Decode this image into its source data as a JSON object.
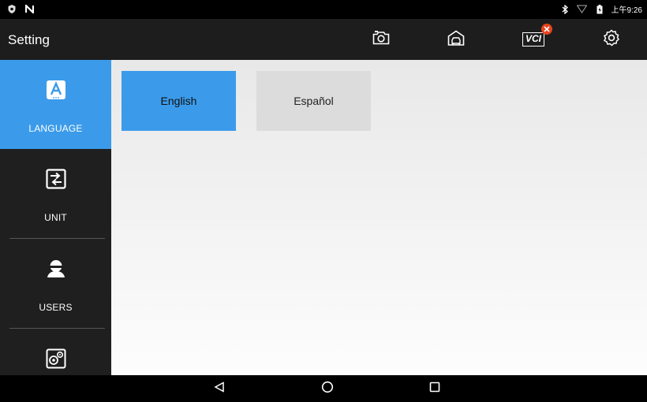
{
  "status_bar": {
    "time": "上午9:26",
    "left_icons": [
      "shield-icon",
      "n-icon"
    ],
    "right_icons": [
      "bluetooth-icon",
      "wifi-icon",
      "battery-icon"
    ]
  },
  "app_bar": {
    "title": "Setting",
    "actions": [
      "camera-icon",
      "garage-icon",
      "vci-icon",
      "gear-icon"
    ],
    "vci_label": "VCI",
    "vci_status": "disconnected"
  },
  "sidebar": {
    "items": [
      {
        "label": "LANGUAGE",
        "icon": "language-icon",
        "active": true
      },
      {
        "label": "UNIT",
        "icon": "unit-icon",
        "active": false
      },
      {
        "label": "USERS",
        "icon": "user-icon",
        "active": false
      },
      {
        "label": "",
        "icon": "system-settings-icon",
        "active": false
      }
    ]
  },
  "languages": [
    {
      "label": "English",
      "selected": true
    },
    {
      "label": "Español",
      "selected": false
    }
  ],
  "colors": {
    "accent": "#3b9bea",
    "appbar": "#1d1d1d",
    "sidebar": "#1f1f1f",
    "badge": "#e6441f"
  }
}
